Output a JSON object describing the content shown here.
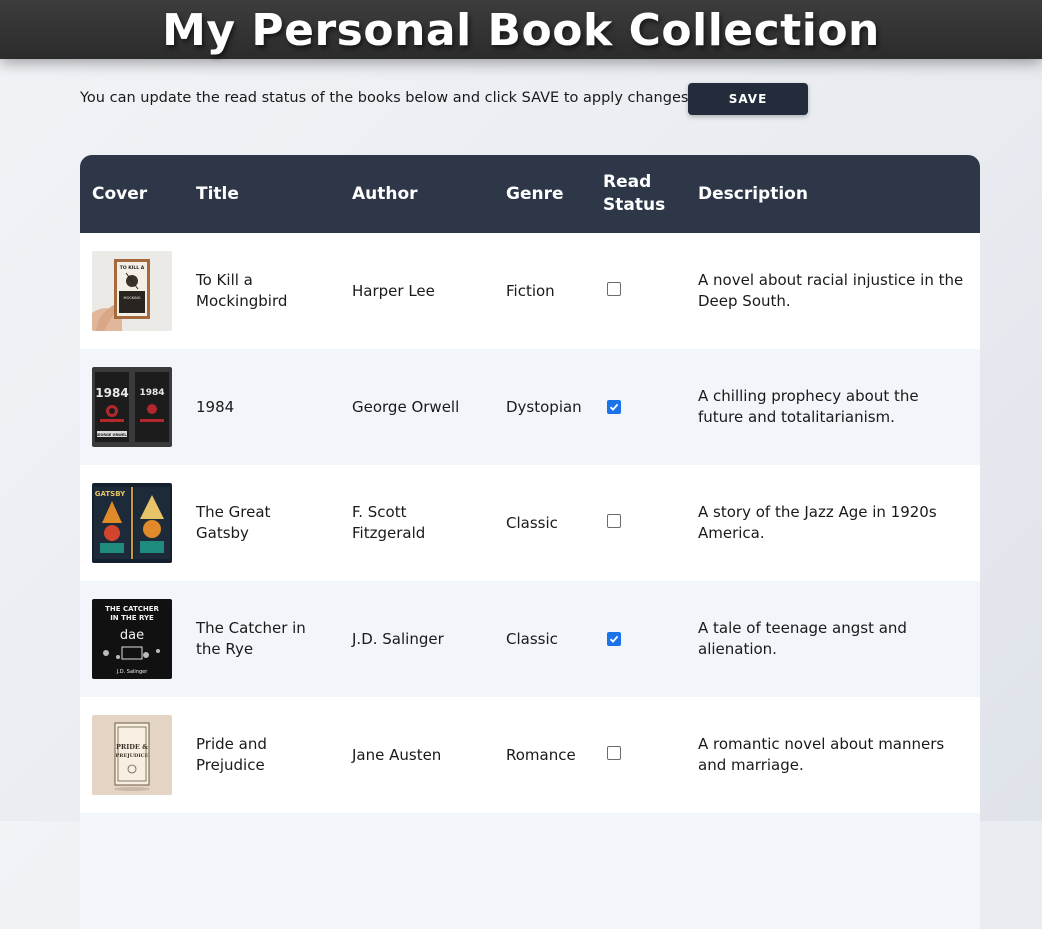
{
  "header": {
    "title": "My Personal Book Collection"
  },
  "intro": {
    "text": "You can update the read status of the books below and click SAVE to apply changes.",
    "save_label": "SAVE"
  },
  "table": {
    "columns": [
      "Cover",
      "Title",
      "Author",
      "Genre",
      "Read Status",
      "Description"
    ],
    "rows": [
      {
        "title": "To Kill a Mockingbird",
        "author": "Harper Lee",
        "genre": "Fiction",
        "read": false,
        "description": "A novel about racial injustice in the Deep South."
      },
      {
        "title": "1984",
        "author": "George Orwell",
        "genre": "Dystopian",
        "read": true,
        "description": "A chilling prophecy about the future and totalitarianism."
      },
      {
        "title": "The Great Gatsby",
        "author": "F. Scott Fitzgerald",
        "genre": "Classic",
        "read": false,
        "description": "A story of the Jazz Age in 1920s America."
      },
      {
        "title": "The Catcher in the Rye",
        "author": "J.D. Salinger",
        "genre": "Classic",
        "read": true,
        "description": "A tale of teenage angst and alienation."
      },
      {
        "title": "Pride and Prejudice",
        "author": "Jane Austen",
        "genre": "Romance",
        "read": false,
        "description": "A romantic novel about manners and marriage."
      }
    ]
  },
  "covers": {
    "0": {
      "lines": [
        "TO KILL A",
        "MOCKING"
      ],
      "alt": "Harper Lee"
    },
    "1": {
      "lines": [
        "1984",
        "1984"
      ],
      "alt": "GEORGE ORWELL"
    },
    "2": {
      "lines": [
        "GATSBY"
      ],
      "alt": ""
    },
    "3": {
      "lines": [
        "THE CATCHER",
        "IN THE RYE",
        "dae"
      ],
      "alt": "J.D. Salinger"
    },
    "4": {
      "lines": [
        "PRIDE &",
        "PREJUDICE"
      ],
      "alt": ""
    }
  },
  "colors": {
    "header_bg": "#2d3748",
    "button_bg": "#232c3b",
    "checkbox_on": "#1a73e8"
  }
}
